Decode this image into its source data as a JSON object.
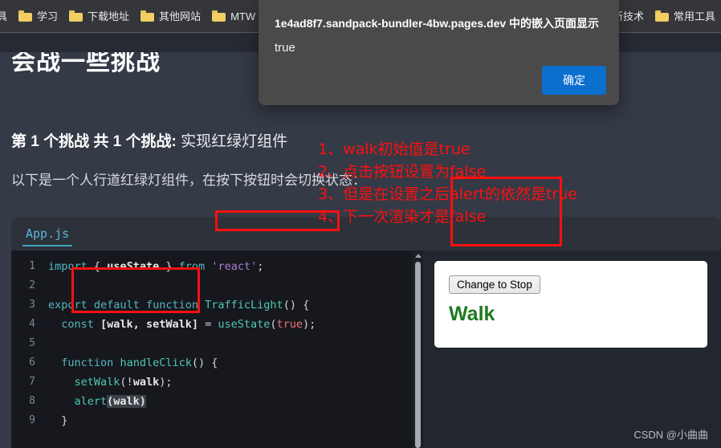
{
  "browser": {
    "bookmarks": [
      {
        "label": "具",
        "icon": "",
        "truncated": true
      },
      {
        "label": "学习",
        "icon": "folder-icon"
      },
      {
        "label": "下载地址",
        "icon": "folder-icon"
      },
      {
        "label": "其他网站",
        "icon": "folder-icon"
      },
      {
        "label": "MTW",
        "icon": "folder-icon"
      }
    ],
    "bookmarks_right": [
      {
        "label": "新技术",
        "icon": ""
      },
      {
        "label": "常用工具",
        "icon": "folder-icon"
      }
    ]
  },
  "dialog": {
    "title": "1e4ad8f7.sandpack-bundler-4bw.pages.dev 中的嵌入页面显示",
    "message": "true",
    "ok_label": "确定"
  },
  "page": {
    "title": "会战一些挑战",
    "challenge_prefix": "第 1 个挑战 共 1 个挑战:",
    "challenge_name": "实现红绿灯组件",
    "description": "以下是一个人行道红绿灯组件，在按下按钮时会切换状态："
  },
  "annotations": {
    "lines": [
      "1、walk初始值是true",
      "2、点击按钮设置为false",
      "3、但是在设置之后alert的依然是true",
      "4、下一次渲染才是false"
    ],
    "color": "#fc1010"
  },
  "sandpack": {
    "tabs": [
      {
        "label": "App.js",
        "active": true
      }
    ],
    "code": [
      {
        "n": "1",
        "tokens": [
          {
            "t": "import",
            "c": "tk-kw"
          },
          {
            "t": " ",
            "c": "tk-punct"
          },
          {
            "t": "{",
            "c": "tk-punct"
          },
          {
            "t": " ",
            "c": "tk-punct"
          },
          {
            "t": "useState",
            "c": "tk-white"
          },
          {
            "t": " ",
            "c": "tk-punct"
          },
          {
            "t": "}",
            "c": "tk-punct"
          },
          {
            "t": " ",
            "c": "tk-punct"
          },
          {
            "t": "from",
            "c": "tk-kw"
          },
          {
            "t": " ",
            "c": "tk-punct"
          },
          {
            "t": "'react'",
            "c": "tk-str"
          },
          {
            "t": ";",
            "c": "tk-punct"
          }
        ]
      },
      {
        "n": "2",
        "tokens": []
      },
      {
        "n": "3",
        "tokens": [
          {
            "t": "export",
            "c": "tk-kw"
          },
          {
            "t": " ",
            "c": "tk-punct"
          },
          {
            "t": "default",
            "c": "tk-kw"
          },
          {
            "t": " ",
            "c": "tk-punct"
          },
          {
            "t": "function",
            "c": "tk-kw"
          },
          {
            "t": " ",
            "c": "tk-punct"
          },
          {
            "t": "TrafficLight",
            "c": "tk-fn"
          },
          {
            "t": "() {",
            "c": "tk-punct"
          }
        ]
      },
      {
        "n": "4",
        "tokens": [
          {
            "t": "  ",
            "c": "tk-punct"
          },
          {
            "t": "const",
            "c": "tk-kw"
          },
          {
            "t": " ",
            "c": "tk-punct"
          },
          {
            "t": "[walk, setWalk]",
            "c": "tk-white"
          },
          {
            "t": " = ",
            "c": "tk-punct"
          },
          {
            "t": "useState",
            "c": "tk-fn"
          },
          {
            "t": "(",
            "c": "tk-punct"
          },
          {
            "t": "true",
            "c": "tk-bool"
          },
          {
            "t": ");",
            "c": "tk-punct"
          }
        ]
      },
      {
        "n": "5",
        "tokens": []
      },
      {
        "n": "6",
        "tokens": [
          {
            "t": "  ",
            "c": "tk-punct"
          },
          {
            "t": "function",
            "c": "tk-kw"
          },
          {
            "t": " ",
            "c": "tk-punct"
          },
          {
            "t": "handleClick",
            "c": "tk-fn"
          },
          {
            "t": "() {",
            "c": "tk-punct"
          }
        ]
      },
      {
        "n": "7",
        "tokens": [
          {
            "t": "    ",
            "c": "tk-punct"
          },
          {
            "t": "setWalk",
            "c": "tk-fn"
          },
          {
            "t": "(!",
            "c": "tk-punct"
          },
          {
            "t": "walk",
            "c": "tk-white"
          },
          {
            "t": ");",
            "c": "tk-punct"
          }
        ]
      },
      {
        "n": "8",
        "tokens": [
          {
            "t": "    ",
            "c": "tk-punct"
          },
          {
            "t": "alert",
            "c": "tk-fn"
          },
          {
            "t": "(walk)",
            "c": "tk-white tk-sel"
          }
        ]
      },
      {
        "n": "9",
        "tokens": [
          {
            "t": "  }",
            "c": "tk-punct"
          }
        ]
      }
    ],
    "preview": {
      "button_label": "Change to Stop",
      "status_label": "Walk",
      "status_color": "#1f7a1f"
    }
  },
  "watermark": "CSDN @小曲曲"
}
